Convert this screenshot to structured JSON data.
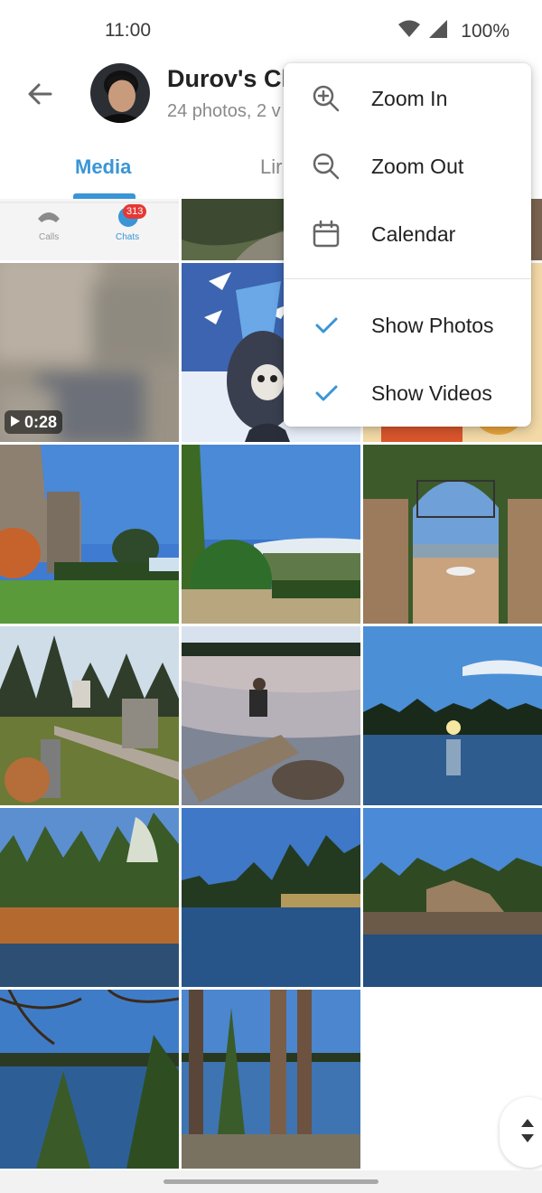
{
  "status_bar": {
    "time": "11:00",
    "battery": "100%",
    "icons": [
      "wifi-icon",
      "signal-icon"
    ]
  },
  "header": {
    "back_icon": "back-arrow-icon",
    "title": "Durov's Ch",
    "subtitle": "24 photos, 2 v"
  },
  "tabs": [
    {
      "label": "Media",
      "active": true
    },
    {
      "label": "Lir",
      "active": false
    }
  ],
  "grid": {
    "video_duration": "0:28",
    "preview_thumb": {
      "calls_label": "Calls",
      "chats_label": "Chats",
      "chats_badge": "313"
    }
  },
  "menu": {
    "items": [
      {
        "label": "Zoom In",
        "icon": "zoom-in-icon"
      },
      {
        "label": "Zoom Out",
        "icon": "zoom-out-icon"
      },
      {
        "label": "Calendar",
        "icon": "calendar-icon"
      },
      {
        "label": "Show Photos",
        "icon": "check-icon",
        "checked": true
      },
      {
        "label": "Show Videos",
        "icon": "check-icon",
        "checked": true
      }
    ]
  },
  "colors": {
    "accent": "#3a95d6",
    "text_primary": "#222222",
    "text_secondary": "#8a8a8a"
  }
}
